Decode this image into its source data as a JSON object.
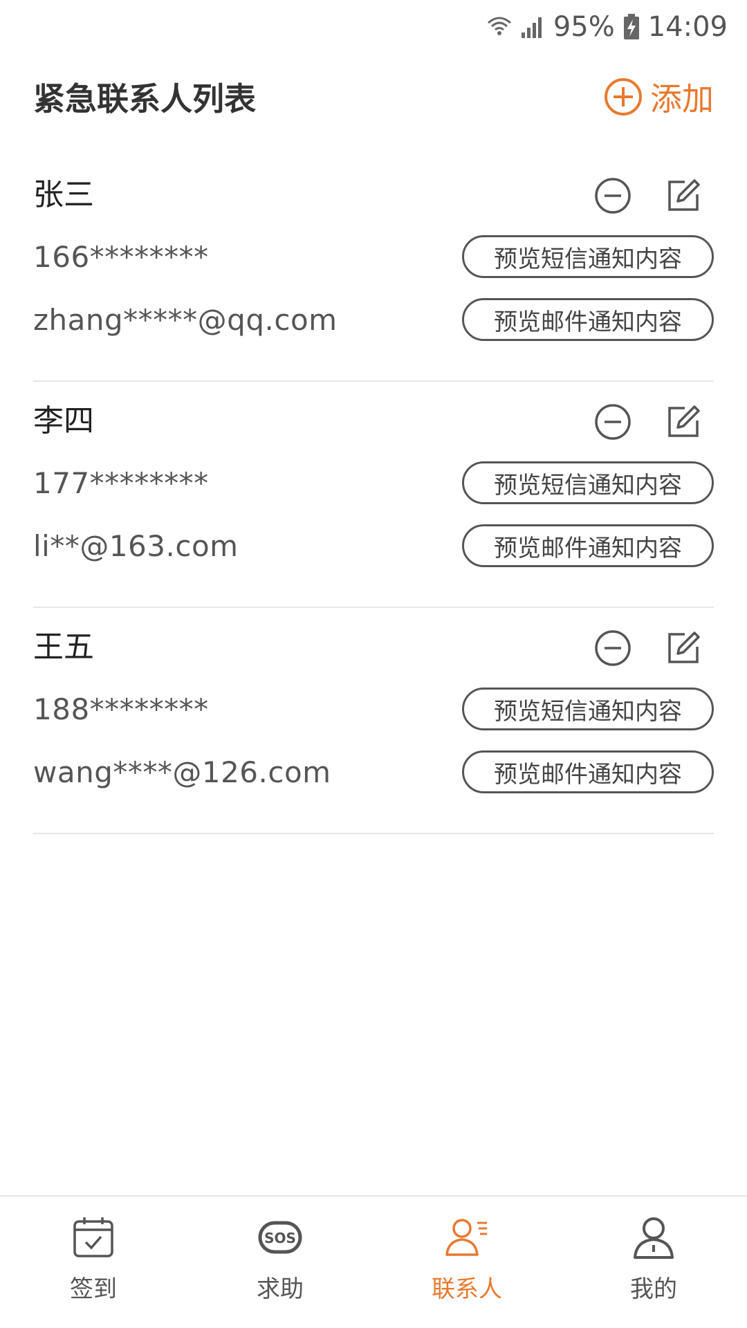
{
  "status_bar": {
    "battery": "95%",
    "time": "14:09"
  },
  "header": {
    "title": "紧急联系人列表",
    "add_label": "添加"
  },
  "contacts": [
    {
      "name": "张三",
      "phone": "166********",
      "email": "zhang*****@qq.com",
      "sms_preview_label": "预览短信通知内容",
      "email_preview_label": "预览邮件通知内容"
    },
    {
      "name": "李四",
      "phone": "177********",
      "email": "li**@163.com",
      "sms_preview_label": "预览短信通知内容",
      "email_preview_label": "预览邮件通知内容"
    },
    {
      "name": "王五",
      "phone": "188********",
      "email": "wang****@126.com",
      "sms_preview_label": "预览短信通知内容",
      "email_preview_label": "预览邮件通知内容"
    }
  ],
  "bottom_nav": {
    "items": [
      {
        "label": "签到",
        "icon": "calendar-check-icon",
        "active": false
      },
      {
        "label": "求助",
        "icon": "sos-icon",
        "active": false
      },
      {
        "label": "联系人",
        "icon": "contacts-icon",
        "active": true
      },
      {
        "label": "我的",
        "icon": "profile-icon",
        "active": false
      }
    ]
  },
  "colors": {
    "accent": "#E8792F",
    "text": "#333333",
    "muted": "#555555",
    "divider": "#e6e6e6"
  }
}
